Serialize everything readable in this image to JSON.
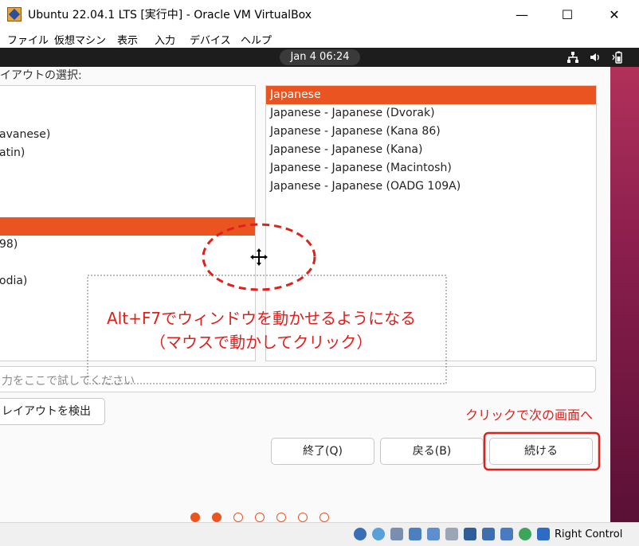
{
  "window": {
    "title": "Ubuntu 22.04.1 LTS [実行中] - Oracle VM VirtualBox",
    "minimize": "—",
    "maximize": "☐",
    "close": "✕"
  },
  "menu": [
    "ファイル",
    "仮想マシン",
    "表示",
    "入力",
    "デバイス",
    "ヘルプ"
  ],
  "topbar": {
    "clock": "Jan 4  06:24"
  },
  "installer": {
    "section_label": "イアウトの選択:",
    "left_list": [
      "avanese)",
      "atin)",
      "",
      "",
      "98)",
      "odia)"
    ],
    "right_list": [
      "Japanese",
      "Japanese - Japanese (Dvorak)",
      "Japanese - Japanese (Kana 86)",
      "Japanese - Japanese (Kana)",
      "Japanese - Japanese (Macintosh)",
      "Japanese - Japanese (OADG 109A)"
    ],
    "test_placeholder": "力をここで試してください",
    "detect_button": "レイアウトを検出",
    "quit_button": "終了(Q)",
    "back_button": "戻る(B)",
    "continue_button": "続ける"
  },
  "annotations": {
    "main_line1": "Alt+F7でウィンドウを動かせるようになる",
    "main_line2": "（マウスで動かしてクリック）",
    "click_note": "クリックで次の画面へ"
  },
  "status": {
    "host_key": "Right Control"
  },
  "colors": {
    "accent": "#e95420",
    "annotation": "#e0201b"
  }
}
